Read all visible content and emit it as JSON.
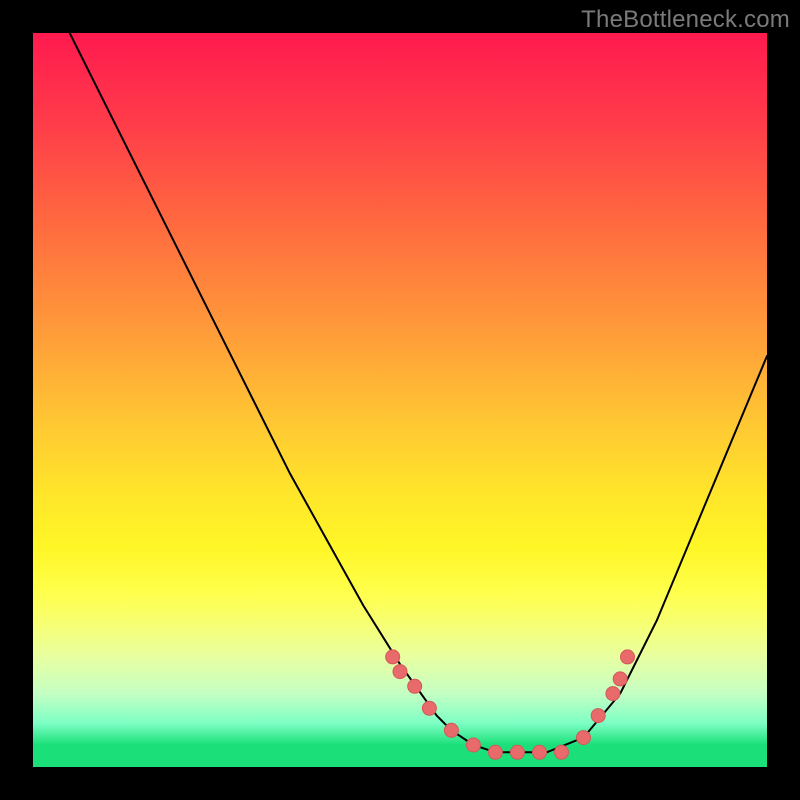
{
  "watermark": "TheBottleneck.com",
  "colors": {
    "background": "#000000",
    "curve_stroke": "#000000",
    "marker_fill": "#e86a6a",
    "marker_stroke": "#d45858"
  },
  "chart_data": {
    "type": "line",
    "title": "",
    "xlabel": "",
    "ylabel": "",
    "xlim": [
      0,
      100
    ],
    "ylim": [
      0,
      100
    ],
    "grid": false,
    "legend": false,
    "curve": {
      "x": [
        5,
        10,
        15,
        20,
        25,
        30,
        35,
        40,
        45,
        50,
        55,
        57,
        60,
        63,
        65,
        70,
        75,
        80,
        85,
        90,
        95,
        100
      ],
      "y": [
        100,
        90,
        80,
        70,
        60,
        50,
        40,
        31,
        22,
        14,
        7,
        5,
        3,
        2,
        2,
        2,
        4,
        10,
        20,
        32,
        44,
        56
      ]
    },
    "markers": {
      "x": [
        49,
        50,
        52,
        54,
        57,
        60,
        63,
        66,
        69,
        72,
        75,
        77,
        79,
        80,
        81
      ],
      "y": [
        15,
        13,
        11,
        8,
        5,
        3,
        2,
        2,
        2,
        2,
        4,
        7,
        10,
        12,
        15
      ]
    }
  }
}
